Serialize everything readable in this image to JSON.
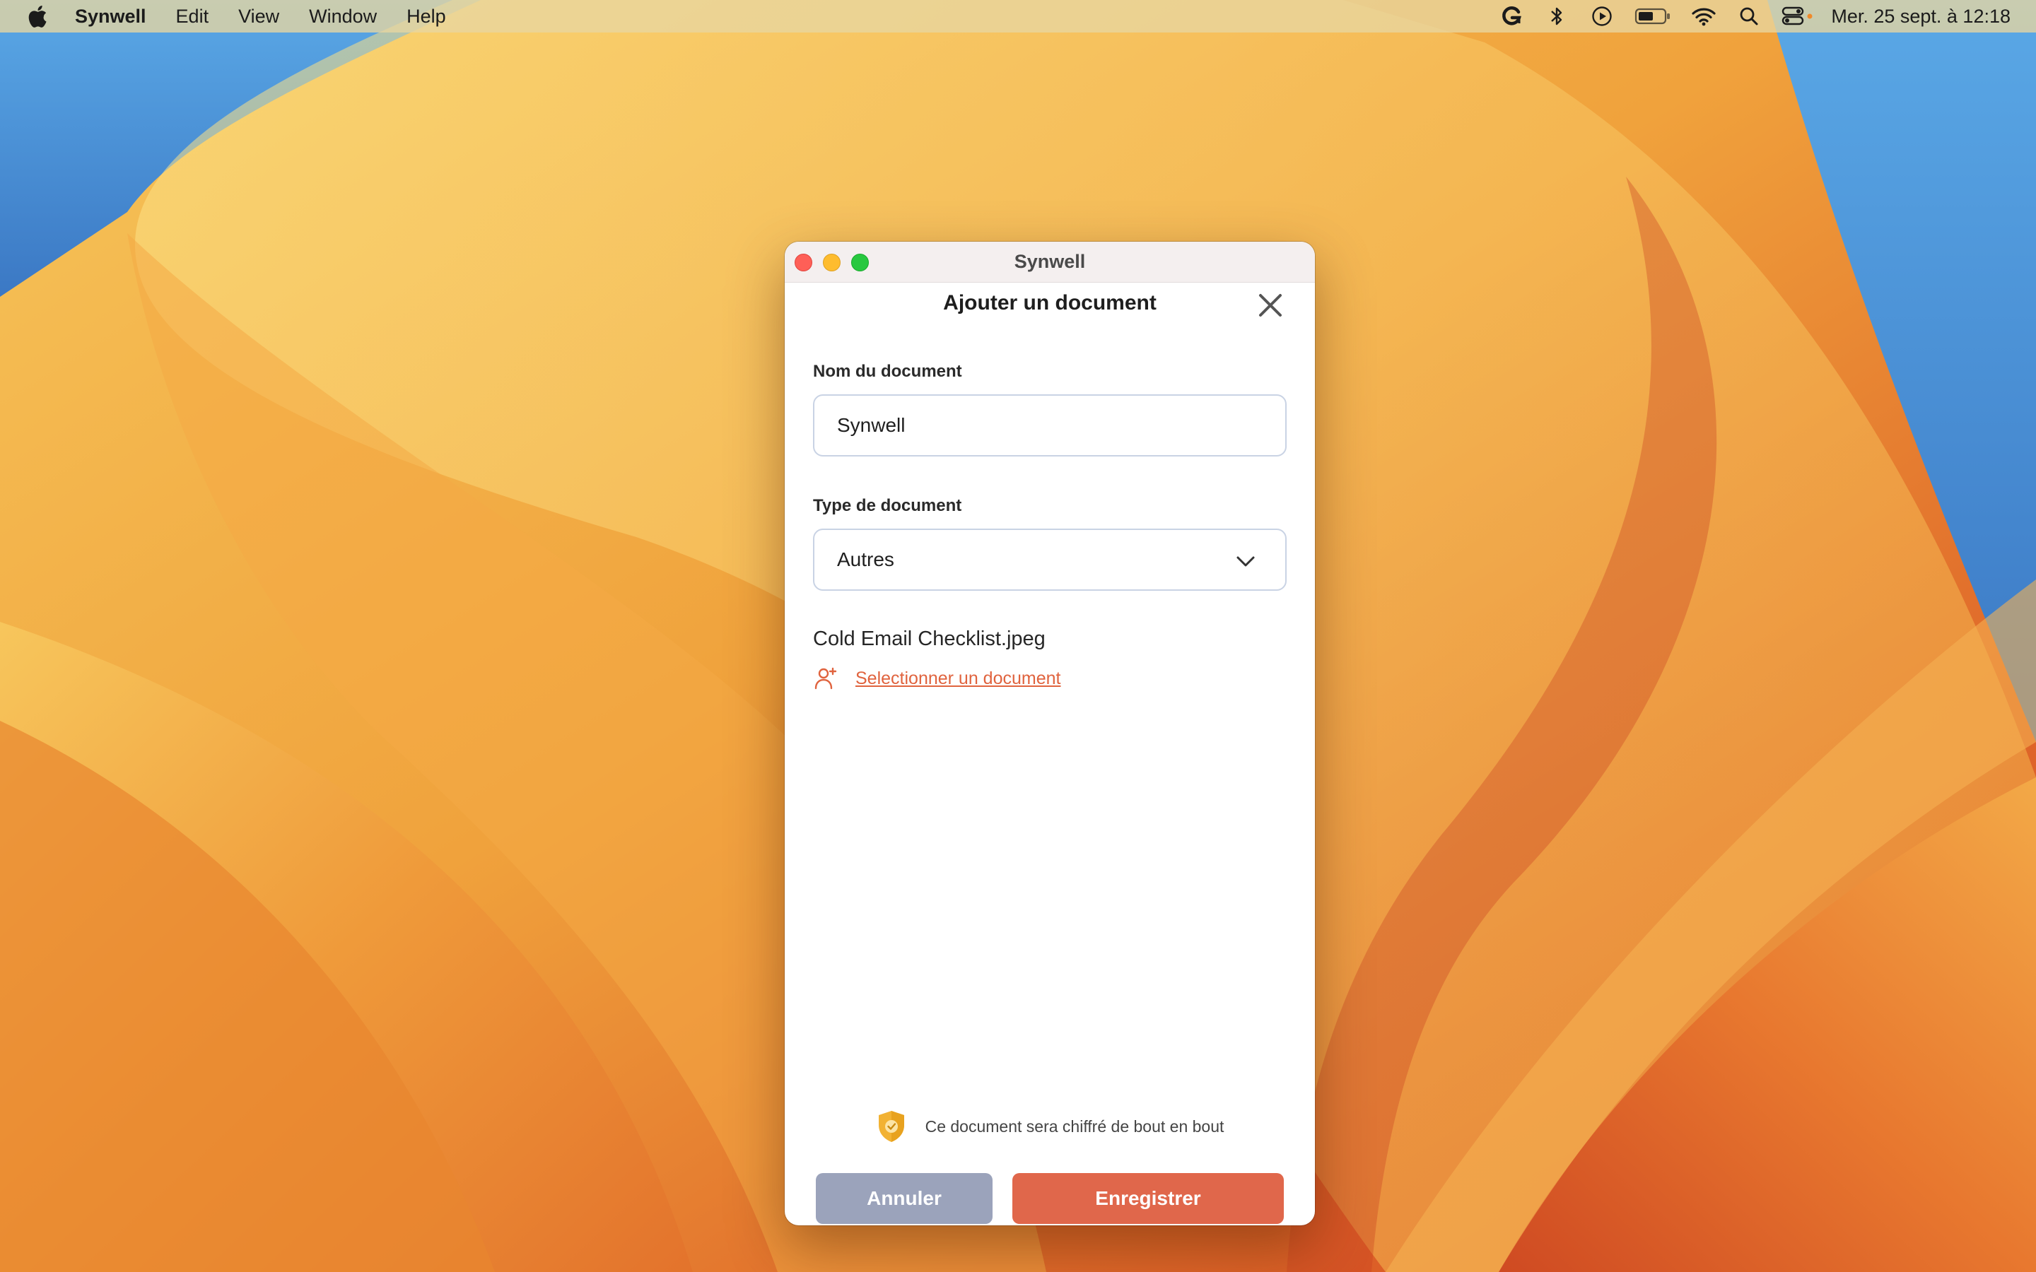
{
  "menubar": {
    "app_name": "Synwell",
    "items": [
      "Edit",
      "View",
      "Window",
      "Help"
    ],
    "status_icons": [
      "grammarly-icon",
      "bluetooth-icon",
      "play-circle-icon",
      "battery-icon",
      "wifi-icon",
      "search-icon",
      "control-center-icon"
    ],
    "clock": "Mer. 25 sept. à 12:18"
  },
  "window": {
    "title": "Synwell"
  },
  "dialog": {
    "title": "Ajouter un document",
    "name_label": "Nom du document",
    "name_value": "Synwell",
    "type_label": "Type de document",
    "type_value": "Autres",
    "filename": "Cold Email Checklist.jpeg",
    "select_link": "Selectionner un document",
    "encrypt_notice": "Ce document sera chiffré de bout en bout",
    "cancel_label": "Annuler",
    "save_label": "Enregistrer"
  },
  "colors": {
    "accent": "#e0674b",
    "link": "#e0633e",
    "cancel": "#9ba3bb",
    "shield": "#f2b233"
  }
}
